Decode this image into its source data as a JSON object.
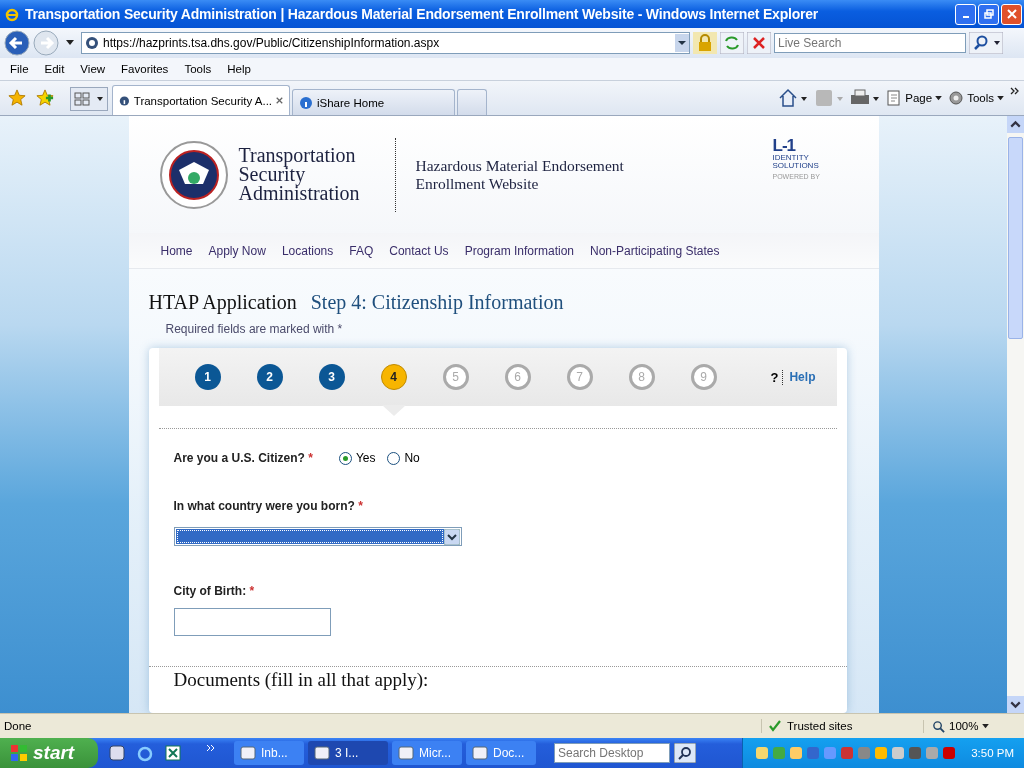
{
  "window": {
    "title": "Transportation Security Administration | Hazardous Material Endorsement Enrollment Website - Windows Internet Explorer"
  },
  "address_bar": {
    "url": "https://hazprints.tsa.dhs.gov/Public/CitizenshipInformation.aspx",
    "search_placeholder": "Live Search"
  },
  "menu": [
    "File",
    "Edit",
    "View",
    "Favorites",
    "Tools",
    "Help"
  ],
  "tabs": [
    {
      "label": "Transportation Security A...",
      "selected": true
    },
    {
      "label": "iShare Home",
      "selected": false
    }
  ],
  "command_bar": [
    "Page",
    "Tools"
  ],
  "page": {
    "agency_name": "Transportation\nSecurity\nAdministration",
    "site_title": "Hazardous Material Endorsement\nEnrollment Website",
    "partner_logo": {
      "mark": "L-1",
      "name": "IDENTITY\nSOLUTIONS",
      "caption": "POWERED BY"
    },
    "nav": [
      "Home",
      "Apply Now",
      "Locations",
      "FAQ",
      "Contact Us",
      "Program Information",
      "Non-Participating States"
    ],
    "heading": "HTAP Application",
    "step_title": "Step 4: Citizenship Information",
    "required_note": "Required fields are marked with *",
    "steps": [
      {
        "number": "1",
        "completed": true,
        "current": false
      },
      {
        "number": "2",
        "completed": true,
        "current": false
      },
      {
        "number": "3",
        "completed": true,
        "current": false
      },
      {
        "number": "4",
        "completed": false,
        "current": true
      },
      {
        "number": "5",
        "completed": false,
        "current": false
      },
      {
        "number": "6",
        "completed": false,
        "current": false
      },
      {
        "number": "7",
        "completed": false,
        "current": false
      },
      {
        "number": "8",
        "completed": false,
        "current": false
      },
      {
        "number": "9",
        "completed": false,
        "current": false
      }
    ],
    "help": {
      "mark": "?",
      "label": "Help"
    },
    "citizen_question": {
      "label": "Are you a U.S. Citizen?",
      "required_mark": "*",
      "options": [
        {
          "label": "Yes",
          "selected": true
        },
        {
          "label": "No",
          "selected": false
        }
      ]
    },
    "country": {
      "label": "In what country were you born?",
      "required_mark": "*",
      "focused": true
    },
    "city": {
      "label": "City of Birth:",
      "required_mark": "*"
    },
    "documents_heading": "Documents (fill in all that apply):"
  },
  "status_bar": {
    "status": "Done",
    "zone": "Trusted sites",
    "zoom": "100%"
  },
  "taskbar": {
    "start": "start",
    "tasks": [
      {
        "label": "Inb...",
        "selected": false
      },
      {
        "label": "3 I...",
        "selected": true
      },
      {
        "label": "Micr...",
        "selected": false
      },
      {
        "label": "Doc...",
        "selected": false
      }
    ],
    "search_placeholder": "Search Desktop",
    "clock": "3:50 PM"
  }
}
